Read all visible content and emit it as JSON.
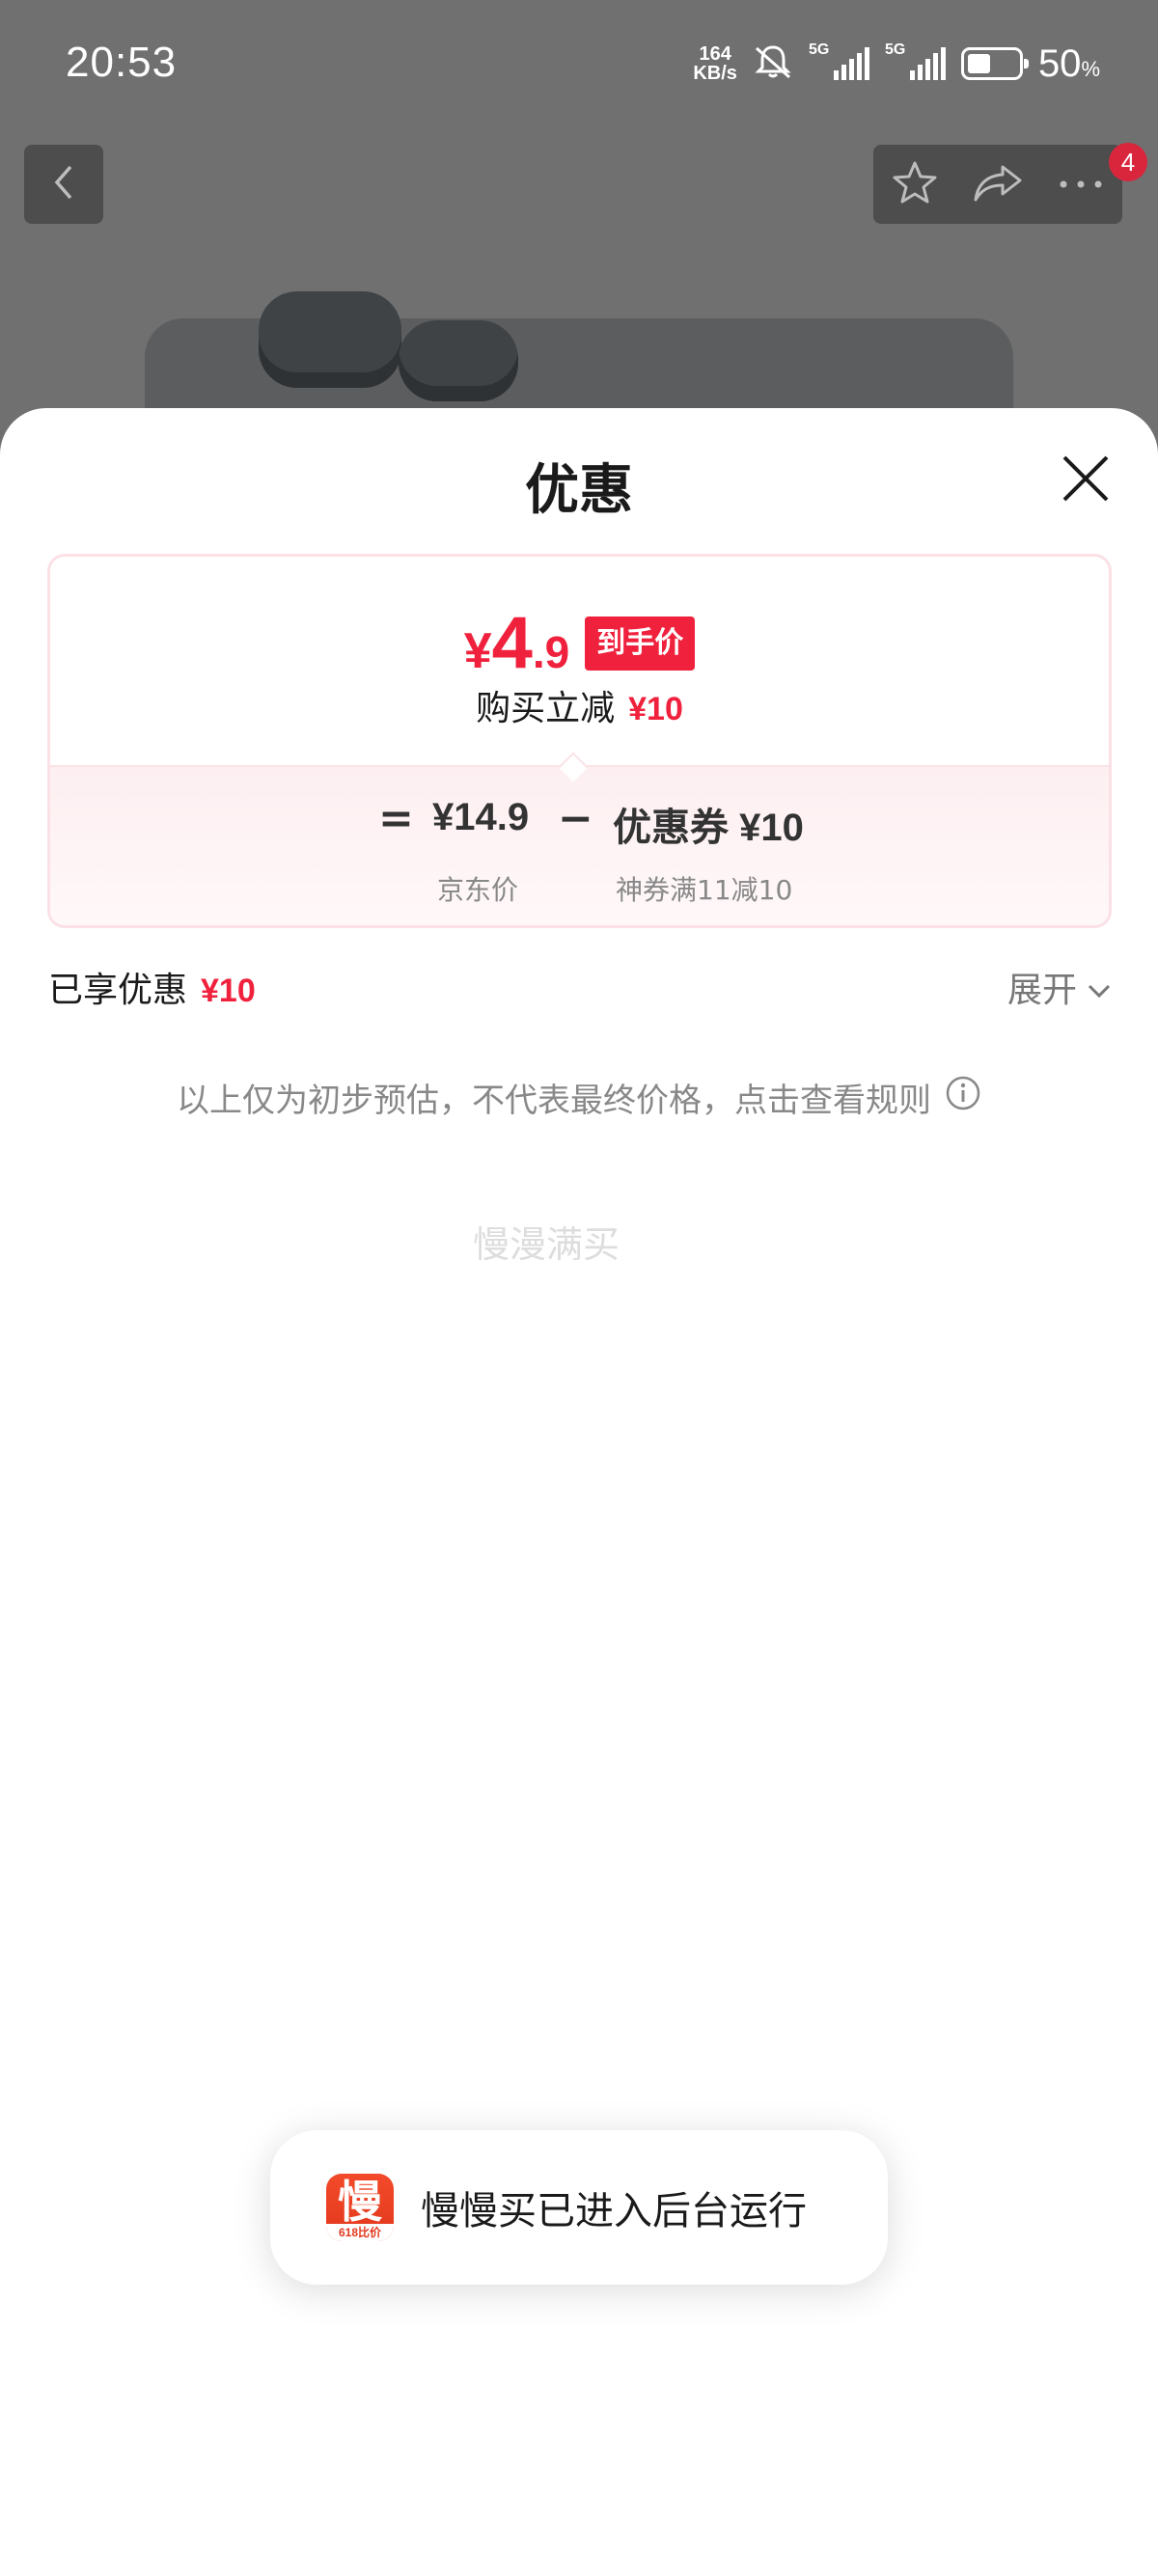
{
  "status_bar": {
    "time": "20:53",
    "net_speed_value": "164",
    "net_speed_unit": "KB/s",
    "sim1_label": "5G",
    "sim2_label": "5G",
    "battery_percent": "50",
    "battery_unit": "%"
  },
  "top_nav": {
    "cart_badge_count": "4"
  },
  "sheet": {
    "title": "优惠",
    "final_price": {
      "currency": "¥",
      "integer": "4",
      "decimal": ".9",
      "tag": "到手价"
    },
    "instant_reduction": {
      "label": "购买立减",
      "amount": "¥10"
    },
    "formula": {
      "equals": "=",
      "minus": "−",
      "base_price": "¥14.9",
      "base_caption": "京东价",
      "coupon_value": "优惠券 ¥10",
      "coupon_caption": "神券满11减10"
    },
    "enjoyed": {
      "label": "已享优惠",
      "amount": "¥10",
      "expand_label": "展开"
    },
    "disclaimer": "以上仅为初步预估，不代表最终价格，点击查看规则",
    "watermark": "慢漫满买"
  },
  "toast": {
    "app_icon_glyph": "慢",
    "app_icon_caption": "618比价",
    "message": "慢慢买已进入后台运行"
  },
  "colors": {
    "accent_red": "#f0213c",
    "overlay_gray": "#707070",
    "badge_red": "#d9263c"
  },
  "icons": [
    "back-chevron-icon",
    "star-icon",
    "share-icon",
    "more-icon",
    "close-icon",
    "chevron-down-icon",
    "info-icon",
    "mute-icon"
  ]
}
